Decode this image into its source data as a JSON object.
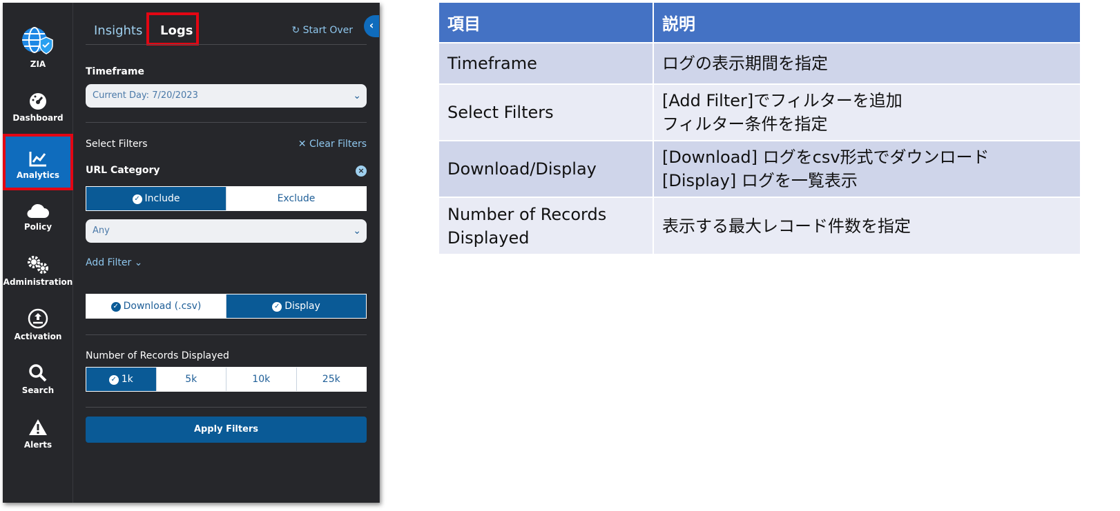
{
  "nav": {
    "items": [
      {
        "label": "ZIA",
        "icon": "globe-shield-icon"
      },
      {
        "label": "Dashboard",
        "icon": "gauge-icon"
      },
      {
        "label": "Analytics",
        "icon": "line-chart-icon"
      },
      {
        "label": "Policy",
        "icon": "cloud-icon"
      },
      {
        "label": "Administration",
        "icon": "gears-icon"
      },
      {
        "label": "Activation",
        "icon": "upload-circle-icon"
      },
      {
        "label": "Search",
        "icon": "search-icon"
      },
      {
        "label": "Alerts",
        "icon": "warning-icon"
      }
    ]
  },
  "tabs": {
    "insights": "Insights",
    "logs": "Logs"
  },
  "start_over": "Start Over",
  "timeframe": {
    "label": "Timeframe",
    "value": "Current Day: 7/20/2023"
  },
  "filters": {
    "label": "Select Filters",
    "clear": "Clear Filters",
    "url_category": "URL Category",
    "include": "Include",
    "exclude": "Exclude",
    "any": "Any",
    "add_filter": "Add Filter"
  },
  "output": {
    "download": "Download (.csv)",
    "display": "Display"
  },
  "records": {
    "label": "Number of Records Displayed",
    "options": [
      "1k",
      "5k",
      "10k",
      "25k"
    ]
  },
  "apply": "Apply Filters",
  "colors": {
    "accent": "#0a5a96",
    "panel": "#26272b",
    "header": "#4472c4",
    "highlight": "#e30613"
  },
  "table": {
    "headers": [
      "項目",
      "説明"
    ],
    "rows": [
      {
        "item": [
          "Timeframe"
        ],
        "desc": [
          "ログの表示期間を指定"
        ]
      },
      {
        "item": [
          "Select Filters"
        ],
        "desc": [
          "[Add Filter]でフィルターを追加",
          "フィルター条件を指定"
        ]
      },
      {
        "item": [
          "Download/Display"
        ],
        "desc": [
          "[Download] ログをcsv形式でダウンロード",
          "[Display] ログを一覧表示"
        ]
      },
      {
        "item": [
          "Number of Records",
          "Displayed"
        ],
        "desc": [
          "表示する最大レコード件数を指定"
        ]
      }
    ]
  }
}
